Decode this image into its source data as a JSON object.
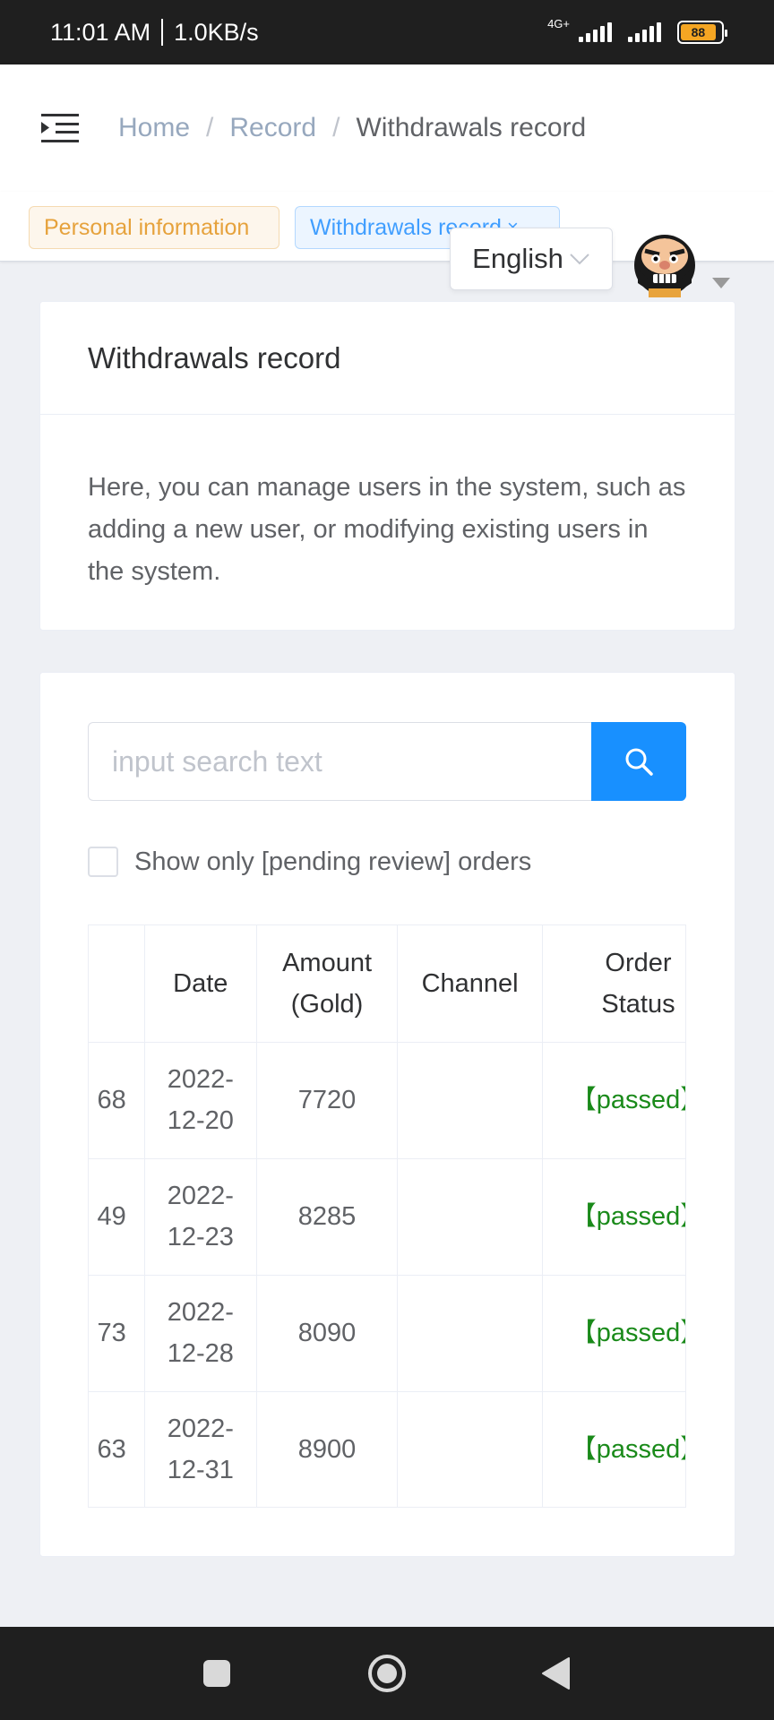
{
  "status_bar": {
    "time": "11:01 AM",
    "speed": "1.0KB/s",
    "network": "4G+",
    "battery": "88"
  },
  "header": {
    "breadcrumb": [
      "Home",
      "Record",
      "Withdrawals record"
    ],
    "separator": "/"
  },
  "tags": {
    "personal": "Personal information",
    "withdrawals": "Withdrawals record",
    "close_symbol": "×"
  },
  "language": {
    "selected": "English"
  },
  "info_card": {
    "title": "Withdrawals record",
    "description": "Here, you can manage users in the system, such as adding a new user, or modifying existing users in the system."
  },
  "search": {
    "placeholder": "input search text",
    "value": ""
  },
  "filter": {
    "pending_only_label": "Show only [pending review] orders",
    "checked": false
  },
  "table": {
    "columns": {
      "date": "Date",
      "amount": "Amount (Gold)",
      "channel": "Channel",
      "status": "Order Status"
    },
    "rows": [
      {
        "id": "68",
        "date": "2022-12-20",
        "amount": "7720",
        "channel": "",
        "status": "【passed】"
      },
      {
        "id": "49",
        "date": "2022-12-23",
        "amount": "8285",
        "channel": "",
        "status": "【passed】"
      },
      {
        "id": "73",
        "date": "2022-12-28",
        "amount": "8090",
        "channel": "",
        "status": "【passed】"
      },
      {
        "id": "63",
        "date": "2022-12-31",
        "amount": "8900",
        "channel": "",
        "status": "【passed】"
      }
    ]
  },
  "colors": {
    "primary": "#1890ff",
    "passed": "#1a8a1a",
    "warning_tag": "#e6a23c",
    "info_tag": "#409eff"
  }
}
